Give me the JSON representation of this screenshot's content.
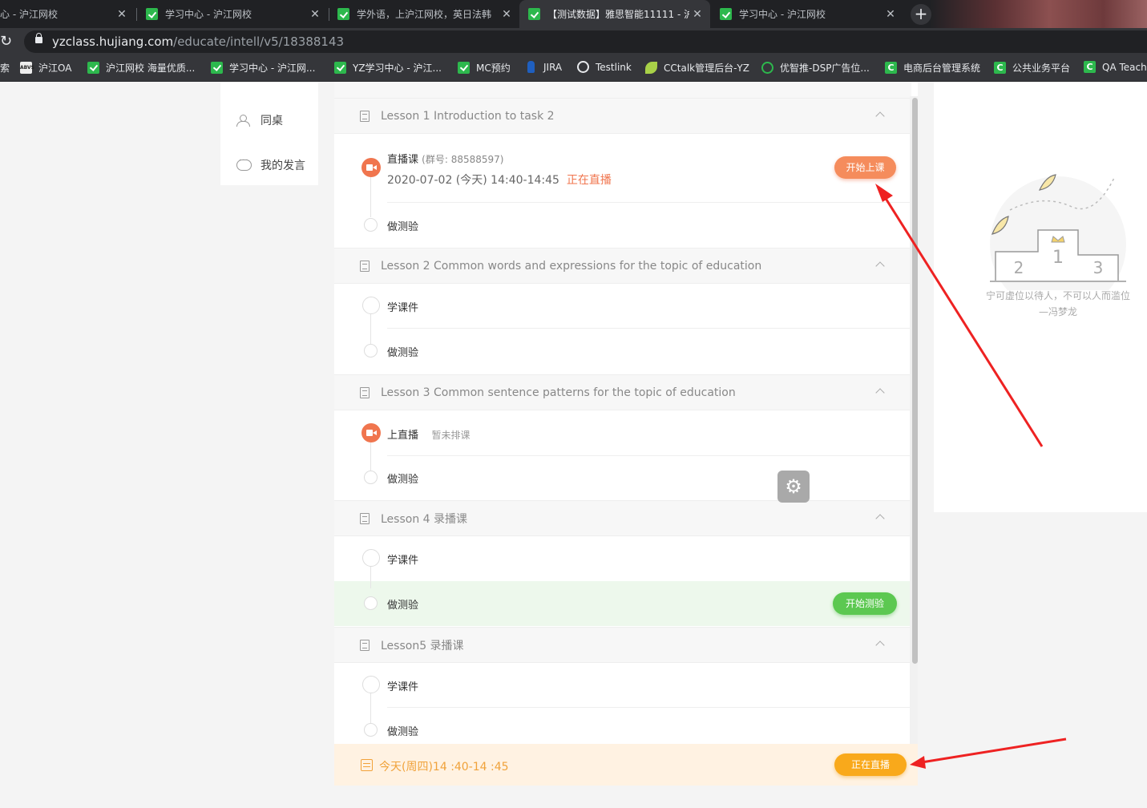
{
  "browser": {
    "tabs": [
      {
        "label": "心 - 沪江网校"
      },
      {
        "label": "学习中心 - 沪江网校"
      },
      {
        "label": "学外语，上沪江网校，英日法韩"
      },
      {
        "label": "【测试数据】雅思智能11111 - 沪"
      },
      {
        "label": "学习中心 - 沪江网校"
      }
    ],
    "url_host": "yzclass.hujiang.com",
    "url_path": "/educate/intell/v5/18388143",
    "bookmarks": [
      {
        "label": "索",
        "icon": "none"
      },
      {
        "label": "沪江OA",
        "icon": "abvs-icon",
        "icon_text": "ABVS"
      },
      {
        "label": "沪江网校 海量优质...",
        "icon": "hujiang-icon"
      },
      {
        "label": "学习中心 - 沪江网...",
        "icon": "hujiang-icon"
      },
      {
        "label": "YZ学习中心 - 沪江...",
        "icon": "hujiang-icon"
      },
      {
        "label": "MC预约",
        "icon": "hujiang-icon"
      },
      {
        "label": "JIRA",
        "icon": "jira-icon"
      },
      {
        "label": "Testlink",
        "icon": "globe-icon"
      },
      {
        "label": "CCtalk管理后台-YZ",
        "icon": "leaf-icon"
      },
      {
        "label": "优智推-DSP广告位...",
        "icon": "ring-icon"
      },
      {
        "label": "电商后台管理系统",
        "icon": "c-icon"
      },
      {
        "label": "公共业务平台",
        "icon": "c-icon"
      },
      {
        "label": "QA Teach",
        "icon": "c-icon"
      }
    ],
    "cc_icon_text": "C"
  },
  "sidebar": {
    "items": [
      {
        "label": "同桌",
        "icon": "users-icon"
      },
      {
        "label": "我的发言",
        "icon": "chat-icon"
      }
    ]
  },
  "lessons": [
    {
      "title": "Lesson 1 Introduction to task 2",
      "items": [
        {
          "type": "live",
          "label": "直播课",
          "group": "(群号: 88588597)",
          "time": "2020-07-02 (今天)  14:40-14:45",
          "status": "正在直播",
          "button": "开始上课"
        },
        {
          "type": "quiz",
          "label": "做测验"
        }
      ]
    },
    {
      "title": "Lesson 2 Common words and expressions for the topic of education",
      "items": [
        {
          "type": "courseware",
          "label": "学课件"
        },
        {
          "type": "quiz",
          "label": "做测验"
        }
      ]
    },
    {
      "title": "Lesson 3 Common sentence patterns for the topic of education",
      "items": [
        {
          "type": "live",
          "label": "上直播",
          "note": "暂未排课"
        },
        {
          "type": "quiz",
          "label": "做测验"
        }
      ]
    },
    {
      "title": "Lesson 4 录播课",
      "items": [
        {
          "type": "courseware",
          "label": "学课件"
        },
        {
          "type": "quiz",
          "label": "做测验",
          "button": "开始测验"
        }
      ]
    },
    {
      "title": "Lesson5 录播课",
      "items": [
        {
          "type": "courseware",
          "label": "学课件"
        },
        {
          "type": "quiz",
          "label": "做测验"
        }
      ]
    }
  ],
  "bottom_bar": {
    "text": "今天(周四)14 :40-14 :45",
    "button": "正在直播"
  },
  "right_panel": {
    "podium": [
      "1",
      "2",
      "3"
    ],
    "quote_line1": "宁可虚位以待人，不可以人而滥位",
    "quote_line2": "—冯梦龙"
  },
  "colors": {
    "accent_orange": "#f58c5c",
    "live_status": "#f0754e",
    "quiz_green": "#5cc851",
    "bottom_yellow": "#f9a91b",
    "annotation_red": "#ee2222"
  }
}
